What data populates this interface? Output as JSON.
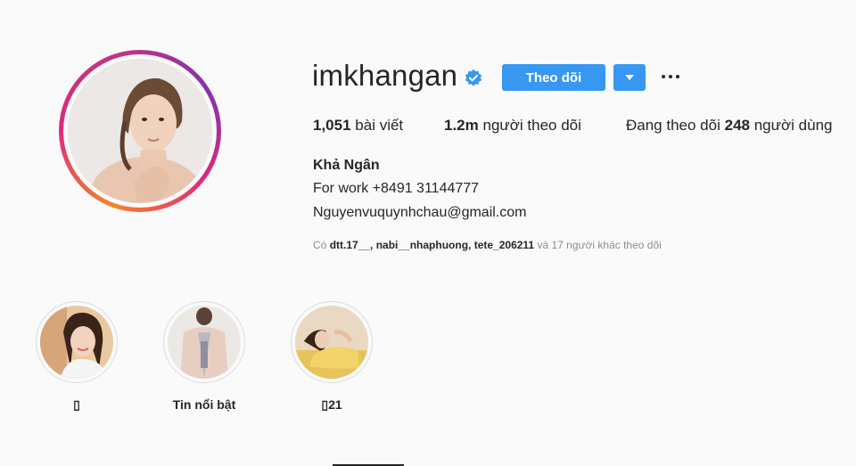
{
  "profile": {
    "username": "imkhangan",
    "follow_label": "Theo dõi",
    "stats": {
      "posts_value": "1,051",
      "posts_label": "bài viết",
      "followers_value": "1.2m",
      "followers_label": "người theo dõi",
      "following_prefix": "Đang theo dõi",
      "following_value": "248",
      "following_suffix": "người dùng"
    },
    "full_name": "Khả Ngân",
    "bio_line1": "For work +8491 31144777",
    "bio_line2": "Nguyenvuquynhchau@gmail.com",
    "followed_by": {
      "prefix": "Có",
      "users": "dtt.17__, nabi__nhaphuong, tete_206211",
      "suffix": "và 17 người khác theo dõi"
    }
  },
  "highlights": [
    {
      "label": "▯"
    },
    {
      "label": "Tin nổi bật"
    },
    {
      "label": "▯21"
    }
  ],
  "colors": {
    "accent": "#3897f0",
    "text": "#262626",
    "muted": "#8e8e8e",
    "background": "#fafafa"
  }
}
